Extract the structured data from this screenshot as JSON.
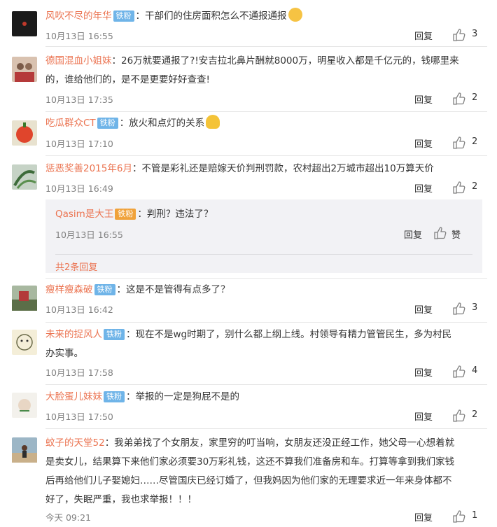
{
  "colors": {
    "username": "#eb7350",
    "badge": "#6fb4e8",
    "badge_gold": "#f0a23b",
    "meta": "#808080"
  },
  "comments": [
    {
      "username": "风吹不尽的年华",
      "badge": "铁粉",
      "text": "：干部们的住房面积怎么不通报通报",
      "emoji": "cat-face-emoji",
      "time": "10月13日 16:55",
      "reply": "回复",
      "likes": "3"
    },
    {
      "username": "德国混血小姐妹",
      "badge": "",
      "text_lines": [
        "：26万就要通报了?!安吉拉北鼻片酬就8000万，明星收入都是千亿元的，钱哪里来",
        "的，谁给他们的，是不是更要好好查查!"
      ],
      "time": "10月13日 17:35",
      "reply": "回复",
      "likes": "2"
    },
    {
      "username": "吃瓜群众CT",
      "badge": "铁粉",
      "text": "：放火和点灯的关系",
      "emoji": "eating-emoji",
      "time": "10月13日 17:10",
      "reply": "回复",
      "likes": "2"
    },
    {
      "username": "惩恶奖善2015年6月",
      "badge": "",
      "text": "：不管是彩礼还是赔嫁天价判刑罚款，农村超出2万城市超出10万算天价",
      "time": "10月13日 16:49",
      "reply": "回复",
      "likes": "2",
      "sub_reply": {
        "username": "Qasim是大王",
        "badge": "铁粉",
        "text": "：判刑？违法了？",
        "time": "10月13日 16:55",
        "reply": "回复",
        "like_label": "赞",
        "more": "共2条回复"
      }
    },
    {
      "username": "瘦样瘦森破",
      "badge": "铁粉",
      "text": "：这是不是管得有点多了？",
      "time": "10月13日 16:42",
      "reply": "回复",
      "likes": "3"
    },
    {
      "username": "未来的捉风人",
      "badge": "铁粉",
      "text_lines": [
        "：现在不是wg时期了，别什么都上纲上线。村领导有精力管管民生，多为村民",
        "办实事。"
      ],
      "time": "10月13日 17:58",
      "reply": "回复",
      "likes": "4"
    },
    {
      "username": "大脸蛋儿妹妹",
      "badge": "铁粉",
      "text": "：举报的一定是狗屁不是的",
      "time": "10月13日 17:50",
      "reply": "回复",
      "likes": "2"
    },
    {
      "username": "蚊子的天堂52",
      "badge": "",
      "text_lines": [
        "：我弟弟找了个女朋友，家里穷的叮当响，女朋友还没正经工作，她父母一心想着就",
        "是卖女儿，结果算下来他们家必须要30万彩礼钱，这还不算我们准备房和车。打算等拿到我们家钱",
        "后再给他们儿子娶媳妇……尽管国庆已经订婚了，但我妈因为他们家的无理要求近一年来身体都不",
        "好了，失眠严重，我也求举报！！！"
      ],
      "time": "今天 09:21",
      "reply": "回复",
      "likes": "1"
    }
  ]
}
